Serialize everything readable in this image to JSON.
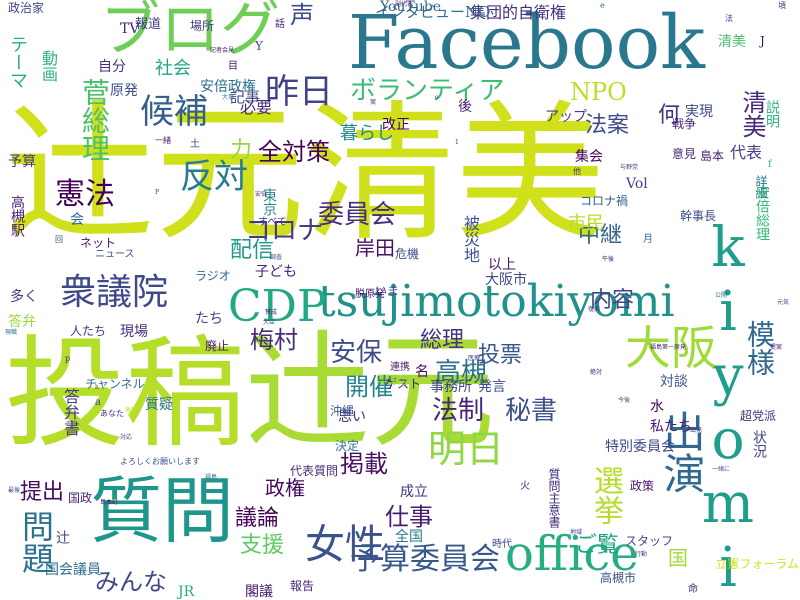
{
  "words": [
    {
      "text": "辻元清美",
      "weight": 100,
      "color": "#d0e11c"
    },
    {
      "text": "投稿",
      "weight": 90,
      "color": "#b5de2b"
    },
    {
      "text": "辻元",
      "weight": 82,
      "color": "#a8db34"
    },
    {
      "text": "Facebook",
      "weight": 70,
      "color": "#2a788e"
    },
    {
      "text": "ブログ",
      "weight": 60,
      "color": "#6ece58"
    },
    {
      "text": "質問",
      "weight": 56,
      "color": "#1f968b"
    },
    {
      "text": "kiyomi",
      "weight": 50,
      "color": "#1f9e89"
    },
    {
      "text": "tsujimotokiyomi",
      "weight": 46,
      "color": "#21918c"
    },
    {
      "text": "CDP",
      "weight": 42,
      "color": "#22a884"
    },
    {
      "text": "office",
      "weight": 42,
      "color": "#26ad81"
    },
    {
      "text": "大阪",
      "weight": 40,
      "color": "#a0da39"
    },
    {
      "text": "出演",
      "weight": 38,
      "color": "#31688e"
    },
    {
      "text": "女性",
      "weight": 36,
      "color": "#3b528b"
    },
    {
      "text": "明日",
      "weight": 36,
      "color": "#90d743"
    },
    {
      "text": "昨日",
      "weight": 34,
      "color": "#414487"
    },
    {
      "text": "衆議院",
      "weight": 34,
      "color": "#3e4989"
    },
    {
      "text": "候補",
      "weight": 32,
      "color": "#355f8d"
    },
    {
      "text": "反対",
      "weight": 32,
      "color": "#287c8e"
    },
    {
      "text": "問題",
      "weight": 32,
      "color": "#2c728e"
    },
    {
      "text": "菅総理",
      "weight": 30,
      "color": "#4ac16d"
    },
    {
      "text": "選挙",
      "weight": 30,
      "color": "#b5de2b"
    },
    {
      "text": "憲法",
      "weight": 30,
      "color": "#440154"
    },
    {
      "text": "模様",
      "weight": 30,
      "color": "#31688e"
    },
    {
      "text": "清美",
      "weight": 28,
      "color": "#482878"
    },
    {
      "text": "予算委員会",
      "weight": 28,
      "color": "#38588c"
    },
    {
      "text": "ボランティア",
      "weight": 28,
      "color": "#3dbc74"
    },
    {
      "text": "法制",
      "weight": 26,
      "color": "#482475"
    },
    {
      "text": "コロナ",
      "weight": 26,
      "color": "#443983"
    },
    {
      "text": "委員会",
      "weight": 26,
      "color": "#472d7b"
    },
    {
      "text": "安保",
      "weight": 26,
      "color": "#3e4c8a"
    },
    {
      "text": "秘書",
      "weight": 26,
      "color": "#3b528b"
    },
    {
      "text": "中継",
      "weight": 26,
      "color": "#32658e"
    },
    {
      "text": "高槻",
      "weight": 24,
      "color": "#2d708e"
    },
    {
      "text": "投票",
      "weight": 24,
      "color": "#39568c"
    },
    {
      "text": "総理",
      "weight": 24,
      "color": "#46327e"
    },
    {
      "text": "梅村",
      "weight": 24,
      "color": "#472c7a"
    },
    {
      "text": "内容",
      "weight": 24,
      "color": "#404688"
    },
    {
      "text": "掲載",
      "weight": 24,
      "color": "#471063"
    },
    {
      "text": "声",
      "weight": 24,
      "color": "#3f4889"
    },
    {
      "text": "仕事",
      "weight": 22,
      "color": "#481b6d"
    },
    {
      "text": "支援",
      "weight": 22,
      "color": "#5ec962"
    },
    {
      "text": "議論",
      "weight": 22,
      "color": "#440154"
    },
    {
      "text": "政権",
      "weight": 22,
      "color": "#45085b"
    },
    {
      "text": "みんな",
      "weight": 22,
      "color": "#3e4a89"
    },
    {
      "text": "開催",
      "weight": 22,
      "color": "#25848e"
    },
    {
      "text": "提出",
      "weight": 22,
      "color": "#460b5e"
    },
    {
      "text": "NPO",
      "weight": 22,
      "color": "#bddf26"
    },
    {
      "text": "何",
      "weight": 22,
      "color": "#46337f"
    },
    {
      "text": "法案",
      "weight": 22,
      "color": "#3e4c8a"
    },
    {
      "text": "配信",
      "weight": 22,
      "color": "#1f988b"
    },
    {
      "text": "全対策",
      "weight": 22,
      "color": "#440256"
    },
    {
      "text": "力",
      "weight": 22,
      "color": "#95d840"
    },
    {
      "text": "ご覧",
      "weight": 20,
      "color": "#20a386"
    },
    {
      "text": "国",
      "weight": 20,
      "color": "#a2da37"
    },
    {
      "text": "暮らし",
      "weight": 18,
      "color": "#228b8d"
    },
    {
      "text": "社会",
      "weight": 18,
      "color": "#21a685"
    },
    {
      "text": "テーマ",
      "weight": 18,
      "color": "#29af7f"
    },
    {
      "text": "岸田",
      "weight": 18,
      "color": "#471164"
    },
    {
      "text": "市民",
      "weight": 18,
      "color": "#b8de29"
    },
    {
      "text": "答弁書",
      "weight": 16,
      "color": "#453781"
    },
    {
      "text": "集団的自衛権",
      "weight": 16,
      "color": "#46307e"
    },
    {
      "text": "インタビューNO",
      "weight": 16,
      "color": "#2d708e"
    },
    {
      "text": "記事",
      "weight": 16,
      "color": "#414487"
    },
    {
      "text": "YouTube",
      "weight": 16,
      "color": "#33638d"
    },
    {
      "text": "必要",
      "weight": 16,
      "color": "#472c7a"
    },
    {
      "text": "予算",
      "weight": 14,
      "color": "#453581"
    },
    {
      "text": "動画",
      "weight": 14,
      "color": "#2fb47c"
    },
    {
      "text": "原発",
      "weight": 14,
      "color": "#3b528b"
    },
    {
      "text": "自分",
      "weight": 14,
      "color": "#46307e"
    },
    {
      "text": "報道",
      "weight": 14,
      "color": "#443983"
    },
    {
      "text": "場所",
      "weight": 14,
      "color": "#433e85"
    },
    {
      "text": "安倍政権",
      "weight": 12,
      "color": "#2e6f8e"
    },
    {
      "text": "政治家",
      "weight": 12,
      "color": "#3f4889"
    },
    {
      "text": "TV",
      "weight": 14,
      "color": "#482475"
    },
    {
      "text": "実現",
      "weight": 14,
      "color": "#3f4788"
    },
    {
      "text": "アップ",
      "weight": 14,
      "color": "#433e85"
    },
    {
      "text": "後",
      "weight": 14,
      "color": "#481d6f"
    },
    {
      "text": "清美",
      "weight": 14,
      "color": "#4ac16d"
    },
    {
      "text": "説明",
      "weight": 12,
      "color": "#2fb47c"
    },
    {
      "text": "戦争",
      "weight": 12,
      "color": "#482677"
    },
    {
      "text": "改正",
      "weight": 14,
      "color": "#440154"
    },
    {
      "text": "集会",
      "weight": 16,
      "color": "#450559"
    },
    {
      "text": "代表",
      "weight": 16,
      "color": "#433e85"
    },
    {
      "text": "意見",
      "weight": 12,
      "color": "#472a7a"
    },
    {
      "text": "島本",
      "weight": 12,
      "color": "#481b6d"
    },
    {
      "text": "Vol",
      "weight": 14,
      "color": "#404588"
    },
    {
      "text": "コロナ禍",
      "weight": 12,
      "color": "#34618d"
    },
    {
      "text": "幹事長",
      "weight": 12,
      "color": "#3d4d8a"
    },
    {
      "text": "詳細",
      "weight": 12,
      "color": "#2a768e"
    },
    {
      "text": "安倍総理",
      "weight": 14,
      "color": "#35b779"
    },
    {
      "text": "被災地",
      "weight": 14,
      "color": "#3b528b"
    },
    {
      "text": "以上",
      "weight": 14,
      "color": "#481a6c"
    },
    {
      "text": "大阪市",
      "weight": 14,
      "color": "#3e4a89"
    },
    {
      "text": "子ども",
      "weight": 14,
      "color": "#482173"
    },
    {
      "text": "高槻駅",
      "weight": 14,
      "color": "#481f70"
    },
    {
      "text": "会",
      "weight": 14,
      "color": "#2e6e8e"
    },
    {
      "text": "東京",
      "weight": 12,
      "color": "#24868e"
    },
    {
      "text": "ネット",
      "weight": 12,
      "color": "#481769"
    },
    {
      "text": "ニュース",
      "weight": 10,
      "color": "#3e4c8a"
    },
    {
      "text": "すべて",
      "weight": 10,
      "color": "#46327e"
    },
    {
      "text": "ラジオ",
      "weight": 12,
      "color": "#2f6c8e"
    },
    {
      "text": "多く",
      "weight": 14,
      "color": "#453882"
    },
    {
      "text": "答弁",
      "weight": 14,
      "color": "#9bd93c"
    },
    {
      "text": "人たち",
      "weight": 12,
      "color": "#46327e"
    },
    {
      "text": "現場",
      "weight": 14,
      "color": "#472e7c"
    },
    {
      "text": "たち",
      "weight": 14,
      "color": "#404588"
    },
    {
      "text": "いま",
      "weight": 14,
      "color": "#3f4889"
    },
    {
      "text": "脱原発",
      "weight": 12,
      "color": "#471164"
    },
    {
      "text": "危機",
      "weight": 10,
      "color": "#3b528b"
    },
    {
      "text": "名",
      "weight": 12,
      "color": "#45085b"
    },
    {
      "text": "思い",
      "weight": 14,
      "color": "#46307e"
    },
    {
      "text": "質疑",
      "weight": 14,
      "color": "#2c728e"
    },
    {
      "text": "沖縄",
      "weight": 14,
      "color": "#375a8c"
    },
    {
      "text": "事務所",
      "weight": 12,
      "color": "#404588"
    },
    {
      "text": "発言",
      "weight": 14,
      "color": "#3d4d8a"
    },
    {
      "text": "ゲスト",
      "weight": 14,
      "color": "#481a6c"
    },
    {
      "text": "連携",
      "weight": 12,
      "color": "#482475"
    },
    {
      "text": "緊急",
      "weight": 10,
      "color": "#8fd744"
    },
    {
      "text": "対談",
      "weight": 10,
      "color": "#3a548c"
    },
    {
      "text": "水",
      "weight": 14,
      "color": "#440154"
    },
    {
      "text": "私たち",
      "weight": 14,
      "color": "#482071"
    },
    {
      "text": "超党派",
      "weight": 14,
      "color": "#472a7a"
    },
    {
      "text": "状況",
      "weight": 12,
      "color": "#404688"
    },
    {
      "text": "特別委員会",
      "weight": 14,
      "color": "#3e4989"
    },
    {
      "text": "決定",
      "weight": 14,
      "color": "#2a788e"
    },
    {
      "text": "代表質問",
      "weight": 12,
      "color": "#472f7d"
    },
    {
      "text": "国政",
      "weight": 12,
      "color": "#482677"
    },
    {
      "text": "成立",
      "weight": 12,
      "color": "#46337f"
    },
    {
      "text": "質問主意書",
      "weight": 14,
      "color": "#46307e"
    },
    {
      "text": "政策",
      "weight": 14,
      "color": "#48186a"
    },
    {
      "text": "全国",
      "weight": 12,
      "color": "#2a788e"
    },
    {
      "text": "時代",
      "weight": 12,
      "color": "#3f4788"
    },
    {
      "text": "スタッフ",
      "weight": 14,
      "color": "#3e4a89"
    },
    {
      "text": "辻",
      "weight": 10,
      "color": "#443a83"
    },
    {
      "text": "国会議員",
      "weight": 12,
      "color": "#2e6e8e"
    },
    {
      "text": "JR",
      "weight": 14,
      "color": "#25ab82"
    },
    {
      "text": "閣議",
      "weight": 14,
      "color": "#481c6e"
    },
    {
      "text": "報告",
      "weight": 14,
      "color": "#482878"
    },
    {
      "text": "高槻市",
      "weight": 14,
      "color": "#3b528b"
    },
    {
      "text": "立憲フォーラム",
      "weight": 12,
      "color": "#d2e21b"
    },
    {
      "text": "チャンネル",
      "weight": 12,
      "color": "#2d718e"
    },
    {
      "text": "廃止",
      "weight": 12,
      "color": "#481769"
    },
    {
      "text": "Y",
      "weight": 12,
      "color": "#3e4989"
    },
    {
      "text": "J",
      "weight": 12,
      "color": "#471365"
    },
    {
      "text": "f",
      "weight": 12,
      "color": "#35b779"
    },
    {
      "text": "命",
      "weight": 12,
      "color": "#472a7a"
    },
    {
      "text": "話",
      "weight": 10,
      "color": "#481b6d"
    },
    {
      "text": "目",
      "weight": 10,
      "color": "#481467"
    },
    {
      "text": "土",
      "weight": 10,
      "color": "#3b528b"
    },
    {
      "text": "火",
      "weight": 10,
      "color": "#46327e"
    },
    {
      "text": "月",
      "weight": 10,
      "color": "#2c728e"
    },
    {
      "text": "a",
      "weight": 10,
      "color": "#3e4a89"
    },
    {
      "text": "p",
      "weight": 10,
      "color": "#482878"
    },
    {
      "text": "回",
      "weight": 10,
      "color": "#3e4c8a"
    },
    {
      "text": "法",
      "weight": 8,
      "color": "#443983"
    },
    {
      "text": "頃",
      "weight": 8,
      "color": "#46337f"
    },
    {
      "text": "1",
      "weight": 8,
      "color": "#481769"
    },
    {
      "text": "o",
      "weight": 8,
      "color": "#3e4989"
    },
    {
      "text": "記者会見",
      "weight": 6,
      "color": "#481c6e"
    },
    {
      "text": "調査",
      "weight": 6,
      "color": "#3b528b"
    },
    {
      "text": "安倍",
      "weight": 6,
      "color": "#46337f"
    },
    {
      "text": "賛成",
      "weight": 6,
      "color": "#482878"
    },
    {
      "text": "大臣",
      "weight": 6,
      "color": "#3e4a89"
    },
    {
      "text": "現職",
      "weight": 6,
      "color": "#2a788e"
    },
    {
      "text": "医療",
      "weight": 6,
      "color": "#404588"
    },
    {
      "text": "絶対",
      "weight": 6,
      "color": "#482475"
    },
    {
      "text": "今後",
      "weight": 6,
      "color": "#3e4c8a"
    },
    {
      "text": "地域",
      "weight": 6,
      "color": "#433e85"
    },
    {
      "text": "出発",
      "weight": 6,
      "color": "#472a7a"
    },
    {
      "text": "公開",
      "weight": 6,
      "color": "#2e6e8e"
    },
    {
      "text": "元気",
      "weight": 6,
      "color": "#3f4889"
    },
    {
      "text": "福島第一原発",
      "weight": 6,
      "color": "#481b6d"
    },
    {
      "text": "復興",
      "weight": 6,
      "color": "#404688"
    },
    {
      "text": "あなた",
      "weight": 6,
      "color": "#46307e"
    },
    {
      "text": "よろしくお願いします",
      "weight": 6,
      "color": "#3b528b"
    },
    {
      "text": "福島",
      "weight": 8,
      "color": "#2c728e"
    },
    {
      "text": "島本町",
      "weight": 8,
      "color": "#481467"
    },
    {
      "text": "行動",
      "weight": 6,
      "color": "#3e4a89"
    },
    {
      "text": "午後",
      "weight": 6,
      "color": "#482071"
    },
    {
      "text": "他",
      "weight": 6,
      "color": "#46327e"
    },
    {
      "text": "与野党",
      "weight": 6,
      "color": "#3e4989"
    },
    {
      "text": "一緒",
      "weight": 6,
      "color": "#481a6c"
    },
    {
      "text": "激論",
      "weight": 8,
      "color": "#bddf26"
    },
    {
      "text": "対応",
      "weight": 6,
      "color": "#443983"
    },
    {
      "text": "大事",
      "weight": 8,
      "color": "#2a788e"
    },
    {
      "text": "副代表",
      "weight": 6,
      "color": "#472c7a"
    },
    {
      "text": "最後",
      "weight": 6,
      "color": "#404588"
    },
    {
      "text": "提案",
      "weight": 6,
      "color": "#481c6e"
    },
    {
      "text": "一緒に",
      "weight": 6,
      "color": "#3b528b"
    },
    {
      "text": "案",
      "weight": 6,
      "color": "#46327e"
    },
    {
      "text": "P",
      "weight": 6,
      "color": "#482878"
    },
    {
      "text": "h",
      "weight": 6,
      "color": "#3e4a89"
    },
    {
      "text": "e",
      "weight": 6,
      "color": "#2c728e"
    },
    {
      "text": "ら",
      "weight": 6,
      "color": "#481769"
    },
    {
      "text": "あと",
      "weight": 6,
      "color": "#433e85"
    },
    {
      "text": "スタート",
      "weight": 6,
      "color": "#3e4c8a"
    },
    {
      "text": "ー",
      "weight": 8,
      "color": "#472a7a"
    }
  ]
}
